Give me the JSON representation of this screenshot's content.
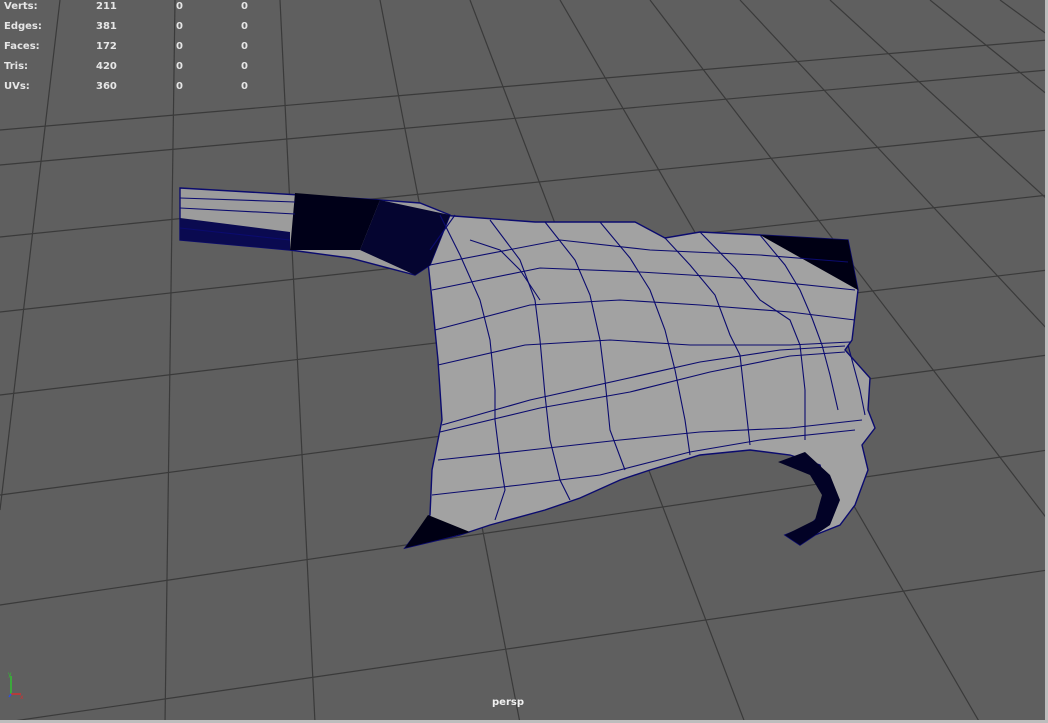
{
  "viewport": {
    "camera_label": "persp",
    "stats": [
      {
        "label": "Verts:",
        "values": [
          "211",
          "0",
          "0"
        ]
      },
      {
        "label": "Edges:",
        "values": [
          "381",
          "0",
          "0"
        ]
      },
      {
        "label": "Faces:",
        "values": [
          "172",
          "0",
          "0"
        ]
      },
      {
        "label": "Tris:",
        "values": [
          "420",
          "0",
          "0"
        ]
      },
      {
        "label": "UVs:",
        "values": [
          "360",
          "0",
          "0"
        ]
      }
    ]
  },
  "colors": {
    "background": "#5f5f5f",
    "grid": "#3a3a3a",
    "mesh_face": "#a2a2a2",
    "wireframe": "#0b0b6e",
    "dense_edges": "#000014",
    "hud_text": "#e6e6e6",
    "axis_x": "#d03030",
    "axis_y": "#30c030",
    "axis_z": "#3050e0"
  },
  "icons": {
    "axis_gizmo": "xyz-axis-icon"
  }
}
